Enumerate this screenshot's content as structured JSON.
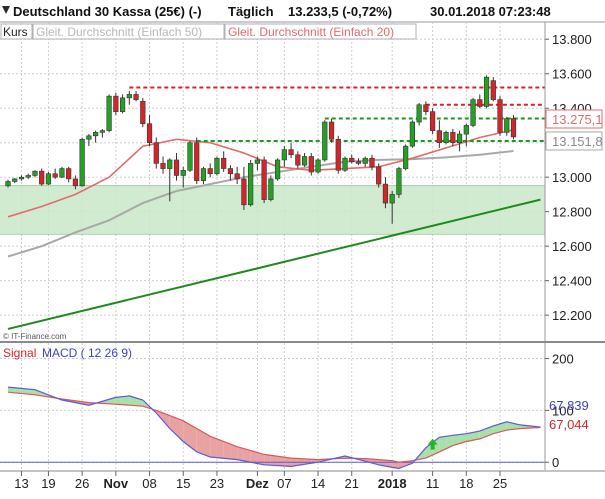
{
  "header": {
    "instrument": "Deutschland 30 Kassa (25€) (-)",
    "interval": "Täglich",
    "quote": "13.233,5 (-0,72%)",
    "datetime": "30.01.2018 07:23:48"
  },
  "main_panel": {
    "kurs_label": "Kurs",
    "legend_ma50": "Gleit. Durchschnitt (Einfach 50)",
    "legend_ma20": "Gleit. Durchschnitt (Einfach 20)",
    "watermark": "© IT-Finance.com",
    "ma20_value": "13.275,1",
    "ma50_value": "13.151,8"
  },
  "macd_panel": {
    "signal_label": "Signal",
    "macd_label": "MACD ( 12 26 9)",
    "macd_value": "67,839",
    "signal_value": "67,044"
  },
  "colors": {
    "bull": "#24a124",
    "bear": "#d3262a",
    "ma20": "#e26b6b",
    "ma50": "#a8a8a8",
    "support_zone": "#c9e7c9",
    "trendline": "#1e8a1e",
    "resistance": "#e02020",
    "support_dash": "#1a9a1a",
    "macd_line": "#5a5ad6",
    "signal_line": "#d55a5a",
    "grid": "#cfcfcf",
    "label_red": "#d3262a",
    "label_blue": "#3f3fc0"
  },
  "chart_data": [
    {
      "type": "candlestick",
      "title": "Deutschland 30 Kassa (25€) (-)",
      "xlabel": "",
      "ylabel": "Kurs",
      "ylim": [
        12050,
        13900
      ],
      "y_ticks": [
        12200,
        12400,
        12600,
        12800,
        13000,
        13200,
        13400,
        13600,
        13800
      ],
      "y_tick_labels": [
        "12.200",
        "12.400",
        "12.600",
        "12.800",
        "13.000",
        "13.200",
        "13.400",
        "13.600",
        "13.800"
      ],
      "x_ticks": [
        "13",
        "19",
        "26",
        "Nov",
        "08",
        "15",
        "23",
        "Dez",
        "07",
        "14",
        "21",
        "2018",
        "11",
        "18",
        "25"
      ],
      "x_tick_sessions": [
        2,
        6,
        11,
        16,
        21,
        26,
        31,
        37,
        41,
        46,
        51,
        57,
        63,
        68,
        73
      ],
      "grid": true,
      "legend_position": "top-left",
      "candles": [
        [
          12950,
          12985,
          12940,
          12975
        ],
        [
          12975,
          12995,
          12965,
          12990
        ],
        [
          12990,
          13010,
          12980,
          13000
        ],
        [
          13000,
          13020,
          12990,
          13010
        ],
        [
          13010,
          13040,
          13000,
          13035
        ],
        [
          13035,
          13050,
          12950,
          12960
        ],
        [
          12960,
          13030,
          12955,
          13020
        ],
        [
          13020,
          13050,
          12990,
          13000
        ],
        [
          13000,
          13060,
          12995,
          13050
        ],
        [
          13050,
          13060,
          12970,
          12990
        ],
        [
          12990,
          13010,
          12930,
          12950
        ],
        [
          12950,
          13230,
          12945,
          13220
        ],
        [
          13220,
          13250,
          13180,
          13240
        ],
        [
          13240,
          13270,
          13200,
          13260
        ],
        [
          13260,
          13280,
          13230,
          13270
        ],
        [
          13270,
          13480,
          13260,
          13470
        ],
        [
          13470,
          13490,
          13360,
          13380
        ],
        [
          13380,
          13480,
          13370,
          13460
        ],
        [
          13460,
          13500,
          13420,
          13480
        ],
        [
          13480,
          13500,
          13440,
          13450
        ],
        [
          13440,
          13460,
          13290,
          13310
        ],
        [
          13310,
          13360,
          13180,
          13200
        ],
        [
          13200,
          13230,
          13050,
          13080
        ],
        [
          13080,
          13120,
          13020,
          13050
        ],
        [
          13050,
          13110,
          12860,
          13100
        ],
        [
          13100,
          13140,
          12980,
          13010
        ],
        [
          13010,
          13060,
          12940,
          13040
        ],
        [
          13040,
          13210,
          13030,
          13200
        ],
        [
          13200,
          13230,
          12960,
          12980
        ],
        [
          12980,
          13060,
          12960,
          13050
        ],
        [
          13050,
          13080,
          13000,
          13020
        ],
        [
          13020,
          13120,
          13010,
          13110
        ],
        [
          13110,
          13150,
          13030,
          13050
        ],
        [
          13050,
          13070,
          12980,
          13020
        ],
        [
          13020,
          13060,
          12960,
          12990
        ],
        [
          12990,
          13060,
          12810,
          12840
        ],
        [
          12840,
          13100,
          12830,
          13080
        ],
        [
          13080,
          13120,
          13040,
          13100
        ],
        [
          13100,
          13120,
          12850,
          12870
        ],
        [
          12870,
          13010,
          12860,
          12990
        ],
        [
          12990,
          13110,
          12980,
          13100
        ],
        [
          13100,
          13180,
          13060,
          13160
        ],
        [
          13160,
          13200,
          13110,
          13130
        ],
        [
          13130,
          13150,
          13050,
          13070
        ],
        [
          13070,
          13140,
          13060,
          13120
        ],
        [
          13120,
          13140,
          13010,
          13030
        ],
        [
          13030,
          13110,
          13020,
          13100
        ],
        [
          13100,
          13330,
          13090,
          13320
        ],
        [
          13320,
          13340,
          13200,
          13220
        ],
        [
          13220,
          13240,
          13020,
          13040
        ],
        [
          13040,
          13120,
          13030,
          13110
        ],
        [
          13110,
          13130,
          13080,
          13090
        ],
        [
          13090,
          13110,
          13070,
          13080
        ],
        [
          13080,
          13120,
          13060,
          13110
        ],
        [
          13110,
          13130,
          13040,
          13060
        ],
        [
          13060,
          13080,
          12940,
          12960
        ],
        [
          12960,
          13000,
          12820,
          12850
        ],
        [
          12850,
          12920,
          12730,
          12900
        ],
        [
          12900,
          13060,
          12880,
          13050
        ],
        [
          13050,
          13190,
          13040,
          13180
        ],
        [
          13180,
          13330,
          13170,
          13320
        ],
        [
          13320,
          13430,
          13300,
          13420
        ],
        [
          13420,
          13440,
          13360,
          13380
        ],
        [
          13380,
          13400,
          13250,
          13270
        ],
        [
          13270,
          13330,
          13170,
          13200
        ],
        [
          13200,
          13270,
          13190,
          13260
        ],
        [
          13260,
          13280,
          13180,
          13200
        ],
        [
          13200,
          13270,
          13150,
          13250
        ],
        [
          13250,
          13310,
          13180,
          13300
        ],
        [
          13300,
          13460,
          13290,
          13450
        ],
        [
          13450,
          13480,
          13400,
          13410
        ],
        [
          13410,
          13590,
          13400,
          13580
        ],
        [
          13560,
          13580,
          13440,
          13450
        ],
        [
          13450,
          13470,
          13240,
          13260
        ],
        [
          13260,
          13350,
          13240,
          13340
        ],
        [
          13340,
          13360,
          13220,
          13233.5
        ]
      ],
      "ma20": [
        [
          0,
          12770
        ],
        [
          5,
          12830
        ],
        [
          10,
          12900
        ],
        [
          15,
          13000
        ],
        [
          20,
          13180
        ],
        [
          25,
          13220
        ],
        [
          30,
          13200
        ],
        [
          35,
          13140
        ],
        [
          40,
          13060
        ],
        [
          45,
          13040
        ],
        [
          50,
          13050
        ],
        [
          55,
          13060
        ],
        [
          60,
          13110
        ],
        [
          65,
          13170
        ],
        [
          70,
          13230
        ],
        [
          75,
          13275.1
        ]
      ],
      "ma50": [
        [
          0,
          12540
        ],
        [
          5,
          12600
        ],
        [
          10,
          12680
        ],
        [
          15,
          12750
        ],
        [
          20,
          12850
        ],
        [
          25,
          12920
        ],
        [
          30,
          12960
        ],
        [
          35,
          13000
        ],
        [
          40,
          13030
        ],
        [
          45,
          13060
        ],
        [
          50,
          13090
        ],
        [
          55,
          13100
        ],
        [
          60,
          13105
        ],
        [
          65,
          13115
        ],
        [
          70,
          13130
        ],
        [
          75,
          13151.8
        ]
      ],
      "support_zone": [
        12670,
        12950
      ],
      "trendline": [
        [
          0,
          12120
        ],
        [
          79,
          12870
        ]
      ],
      "resistance_levels": [
        {
          "level": 13520,
          "from": 18,
          "to": 79
        },
        {
          "level": 13420,
          "from": 62,
          "to": 79
        }
      ],
      "support_levels": [
        {
          "level": 13340,
          "from": 47,
          "to": 79
        },
        {
          "level": 13210,
          "from": 28,
          "to": 79
        }
      ]
    },
    {
      "type": "area",
      "title": "MACD ( 12 26 9)",
      "ylim": [
        -15,
        230
      ],
      "y_ticks": [
        0,
        100,
        200
      ],
      "y_tick_labels": [
        "0",
        "100",
        "200"
      ],
      "series": [
        {
          "name": "MACD ( 12 26 9)",
          "values": [
            [
              0,
              145
            ],
            [
              4,
              140
            ],
            [
              8,
              120
            ],
            [
              12,
              110
            ],
            [
              16,
              125
            ],
            [
              18,
              128
            ],
            [
              20,
              120
            ],
            [
              22,
              95
            ],
            [
              24,
              65
            ],
            [
              26,
              40
            ],
            [
              28,
              20
            ],
            [
              30,
              10
            ],
            [
              34,
              5
            ],
            [
              38,
              -5
            ],
            [
              42,
              -8
            ],
            [
              46,
              0
            ],
            [
              50,
              12
            ],
            [
              53,
              2
            ],
            [
              55,
              -5
            ],
            [
              57,
              -10
            ],
            [
              58,
              -12
            ],
            [
              60,
              -2
            ],
            [
              62,
              28
            ],
            [
              64,
              48
            ],
            [
              66,
              52
            ],
            [
              68,
              55
            ],
            [
              70,
              60
            ],
            [
              72,
              70
            ],
            [
              74,
              78
            ],
            [
              76,
              72
            ],
            [
              79,
              67.839
            ]
          ]
        },
        {
          "name": "Signal",
          "values": [
            [
              0,
              135
            ],
            [
              4,
              130
            ],
            [
              8,
              122
            ],
            [
              12,
              115
            ],
            [
              16,
              112
            ],
            [
              18,
              110
            ],
            [
              20,
              108
            ],
            [
              22,
              100
            ],
            [
              24,
              90
            ],
            [
              26,
              80
            ],
            [
              28,
              65
            ],
            [
              30,
              50
            ],
            [
              34,
              30
            ],
            [
              38,
              15
            ],
            [
              42,
              8
            ],
            [
              46,
              5
            ],
            [
              50,
              8
            ],
            [
              53,
              7
            ],
            [
              55,
              5
            ],
            [
              57,
              3
            ],
            [
              58,
              0
            ],
            [
              60,
              3
            ],
            [
              62,
              8
            ],
            [
              64,
              20
            ],
            [
              66,
              32
            ],
            [
              68,
              40
            ],
            [
              70,
              45
            ],
            [
              72,
              55
            ],
            [
              74,
              62
            ],
            [
              76,
              65
            ],
            [
              79,
              67.044
            ]
          ]
        }
      ],
      "signal_marker": {
        "session": 63,
        "type": "arrow-up"
      }
    }
  ]
}
